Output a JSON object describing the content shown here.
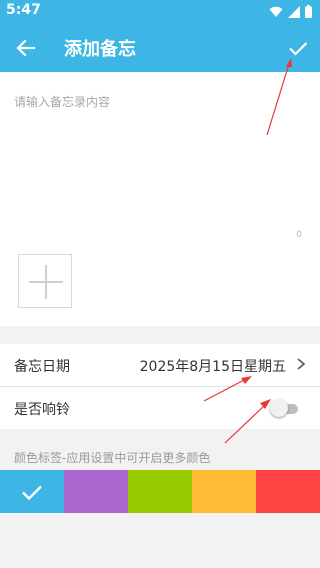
{
  "status_bar": {
    "time": "5:47"
  },
  "app_bar": {
    "title": "添加备忘"
  },
  "editor": {
    "placeholder": "请输入备忘录内容",
    "char_count": "0"
  },
  "settings": {
    "date_label": "备忘日期",
    "date_value": "2025年8月15日星期五",
    "ring_label": "是否响铃",
    "ring_enabled": false
  },
  "color_tags": {
    "label": "颜色标签-应用设置中可开启更多颜色",
    "colors": [
      "#3db6e5",
      "#a966cc",
      "#99cc00",
      "#ffbb33",
      "#ff4444"
    ],
    "selected_index": 0
  },
  "colors": {
    "primary": "#3db6e5",
    "annotation_arrow": "#e53935"
  }
}
